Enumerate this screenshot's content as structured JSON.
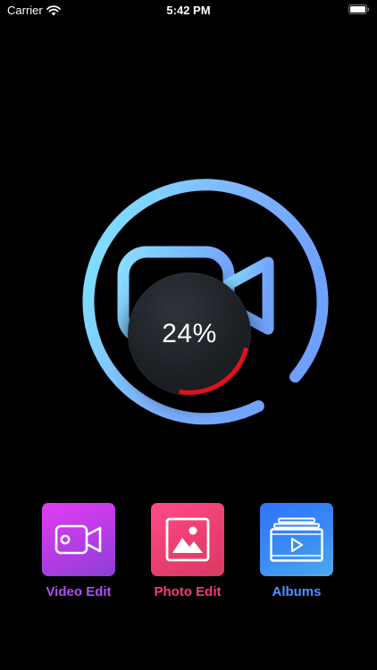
{
  "status_bar": {
    "carrier": "Carrier",
    "time": "5:42 PM"
  },
  "progress": {
    "percent_label": "24%",
    "value": 0.24,
    "arc_color": "#e3101a"
  },
  "hero": {
    "icon": "video-camera-icon",
    "ring_colors": [
      "#7fe8ff",
      "#7fb2ff",
      "#6ea0ff"
    ]
  },
  "actions": [
    {
      "label": "Video Edit",
      "icon": "video-camera-icon",
      "color": "#b24ff0"
    },
    {
      "label": "Photo Edit",
      "icon": "image-icon",
      "color": "#f23d78"
    },
    {
      "label": "Albums",
      "icon": "film-album-icon",
      "color": "#4e90ff"
    }
  ]
}
